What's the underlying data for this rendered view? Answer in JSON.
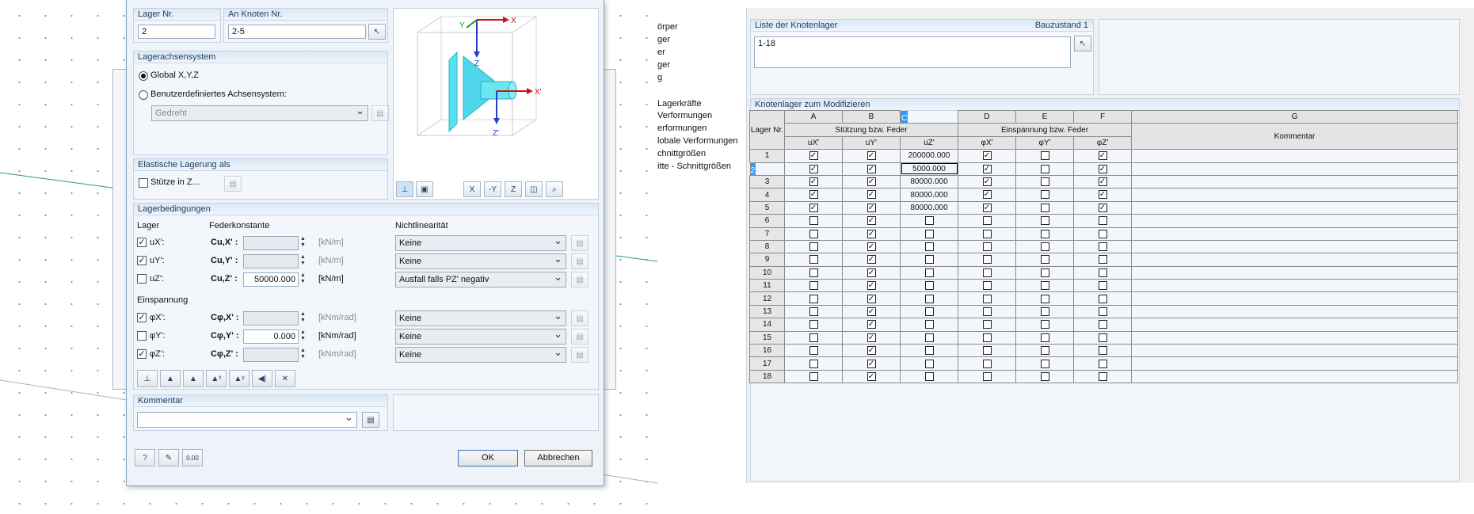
{
  "dialog": {
    "lager_nr": {
      "label": "Lager Nr.",
      "value": "2"
    },
    "an_knoten": {
      "label": "An Knoten Nr.",
      "value": "2-5"
    },
    "achsensystem": {
      "title": "Lagerachsensystem",
      "global": "Global X,Y,Z",
      "custom": "Benutzerdefiniertes Achsensystem:",
      "custom_value": "Gedreht"
    },
    "elastisch": {
      "title": "Elastische Lagerung als",
      "stuetze": "Stütze in Z..."
    },
    "preview_axes": {
      "x": "X",
      "y": "Y",
      "z": "Z",
      "x2": "X'",
      "z2": "Z'"
    },
    "bedingungen": {
      "title": "Lagerbedingungen",
      "col_lager": "Lager",
      "col_feder": "Federkonstante",
      "col_nicht": "Nichtlinearität",
      "rows": [
        {
          "label": "uX':",
          "checked": "✓",
          "const": "Cu,X' :",
          "value": "",
          "unit": "[kN/m]",
          "nl": "Keine"
        },
        {
          "label": "uY':",
          "checked": "✓",
          "const": "Cu,Y' :",
          "value": "",
          "unit": "[kN/m]",
          "nl": "Keine"
        },
        {
          "label": "uZ':",
          "checked": "",
          "const": "Cu,Z' :",
          "value": "50000.000",
          "unit": "[kN/m]",
          "nl": "Ausfall falls PZ' negativ"
        }
      ],
      "einspannung": "Einspannung",
      "rows2": [
        {
          "label": "φX':",
          "checked": "✓",
          "const": "Cφ,X' :",
          "value": "",
          "unit": "[kNm/rad]",
          "nl": "Keine"
        },
        {
          "label": "φY':",
          "checked": "",
          "const": "Cφ,Y' :",
          "value": "0.000",
          "unit": "[kNm/rad]",
          "nl": "Keine"
        },
        {
          "label": "φZ':",
          "checked": "✓",
          "const": "Cφ,Z' :",
          "value": "",
          "unit": "[kNm/rad]",
          "nl": "Keine"
        }
      ]
    },
    "kommentar": {
      "title": "Kommentar",
      "value": ""
    },
    "ok": "OK",
    "abbrechen": "Abbrechen",
    "calc_icon_text": "0.00"
  },
  "nav": {
    "items": [
      "örper",
      "ger",
      "er",
      "ger",
      "g",
      "Lagerkräfte",
      "Verformungen",
      "erformungen",
      "lobale Verformungen",
      "chnittgrößen",
      "itte - Schnittgrößen"
    ]
  },
  "right": {
    "liste": {
      "title": "Liste der Knotenlager",
      "bauzustand": "Bauzustand 1",
      "value": "1-18"
    },
    "table_title": "Knotenlager zum Modifizieren",
    "letters": [
      "A",
      "B",
      "C",
      "D",
      "E",
      "F",
      "G"
    ],
    "row_header": "Lager Nr.",
    "group1": "Stützung bzw. Feder",
    "group2": "Einspannung bzw. Feder",
    "subheads": [
      "uX'",
      "uY'",
      "uZ'",
      "φX'",
      "φY'",
      "φZ'"
    ],
    "kommentar": "Kommentar",
    "rows": [
      {
        "n": "1",
        "a": "✓",
        "b": "✓",
        "c": "200000.000",
        "d": "✓",
        "e": "",
        "f": "✓"
      },
      {
        "n": "2",
        "a": "✓",
        "b": "✓",
        "c": "5000.000",
        "d": "✓",
        "e": "",
        "f": "✓"
      },
      {
        "n": "3",
        "a": "✓",
        "b": "✓",
        "c": "80000.000",
        "d": "✓",
        "e": "",
        "f": "✓"
      },
      {
        "n": "4",
        "a": "✓",
        "b": "✓",
        "c": "80000.000",
        "d": "✓",
        "e": "",
        "f": "✓"
      },
      {
        "n": "5",
        "a": "✓",
        "b": "✓",
        "c": "80000.000",
        "d": "✓",
        "e": "",
        "f": "✓"
      },
      {
        "n": "6",
        "a": "",
        "b": "✓",
        "c": "",
        "d": "",
        "e": "",
        "f": ""
      },
      {
        "n": "7",
        "a": "",
        "b": "✓",
        "c": "",
        "d": "",
        "e": "",
        "f": ""
      },
      {
        "n": "8",
        "a": "",
        "b": "✓",
        "c": "",
        "d": "",
        "e": "",
        "f": ""
      },
      {
        "n": "9",
        "a": "",
        "b": "✓",
        "c": "",
        "d": "",
        "e": "",
        "f": ""
      },
      {
        "n": "10",
        "a": "",
        "b": "✓",
        "c": "",
        "d": "",
        "e": "",
        "f": ""
      },
      {
        "n": "11",
        "a": "",
        "b": "✓",
        "c": "",
        "d": "",
        "e": "",
        "f": ""
      },
      {
        "n": "12",
        "a": "",
        "b": "✓",
        "c": "",
        "d": "",
        "e": "",
        "f": ""
      },
      {
        "n": "13",
        "a": "",
        "b": "✓",
        "c": "",
        "d": "",
        "e": "",
        "f": ""
      },
      {
        "n": "14",
        "a": "",
        "b": "✓",
        "c": "",
        "d": "",
        "e": "",
        "f": ""
      },
      {
        "n": "15",
        "a": "",
        "b": "✓",
        "c": "",
        "d": "",
        "e": "",
        "f": ""
      },
      {
        "n": "16",
        "a": "",
        "b": "✓",
        "c": "",
        "d": "",
        "e": "",
        "f": ""
      },
      {
        "n": "17",
        "a": "",
        "b": "✓",
        "c": "",
        "d": "",
        "e": "",
        "f": ""
      },
      {
        "n": "18",
        "a": "",
        "b": "✓",
        "c": "",
        "d": "",
        "e": "",
        "f": ""
      }
    ]
  }
}
